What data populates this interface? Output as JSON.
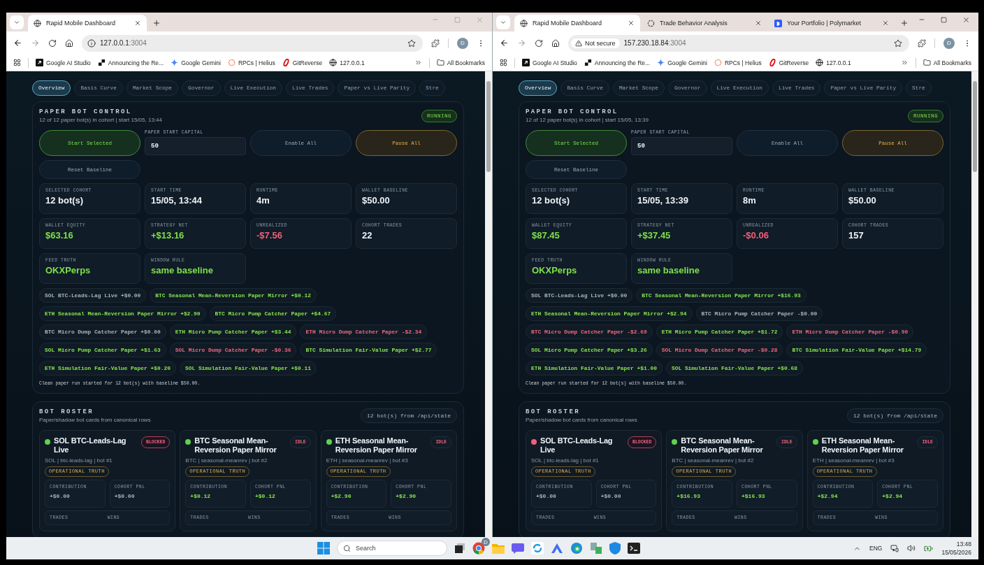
{
  "windows": [
    {
      "active": false,
      "tabs": [
        {
          "title": "Rapid Mobile Dashboard",
          "kind": "globe",
          "selected": true
        }
      ],
      "address": {
        "host": "127.0.0.1",
        "port": ":3004"
      },
      "profile_initial": "D",
      "bookmarks": [
        {
          "label": "Google AI Studio",
          "kind": "square"
        },
        {
          "label": "Announcing the Re...",
          "kind": "shape"
        },
        {
          "label": "Google Gemini",
          "kind": "sparkle"
        },
        {
          "label": "RPCs | Helius",
          "kind": "ring"
        },
        {
          "label": "GitReverse",
          "kind": "oval"
        },
        {
          "label": "127.0.0.1",
          "kind": "globe"
        }
      ],
      "bookmarks_folder": "All Bookmarks",
      "nav": [
        {
          "label": "Overview",
          "selected": true
        },
        {
          "label": "Basis Curve",
          "selected": false
        },
        {
          "label": "Market Scope",
          "selected": false
        },
        {
          "label": "Governor",
          "selected": false
        },
        {
          "label": "Live Execution",
          "selected": false
        },
        {
          "label": "Live Trades",
          "selected": false
        },
        {
          "label": "Paper vs Live Parity",
          "selected": false
        },
        {
          "label": "Stre",
          "selected": false
        }
      ],
      "control": {
        "title": "PAPER BOT CONTROL",
        "subtitle": "12 of 12 paper bot(s) in cohort | start 15/05, 13:44",
        "status": "RUNNING",
        "capital": {
          "label": "PAPER START CAPITAL",
          "value": "50"
        },
        "buttons": [
          {
            "label": "Start Selected",
            "kind": "start"
          },
          {
            "label": "Enable All",
            "kind": "plain"
          },
          {
            "label": "Pause All",
            "kind": "pause"
          },
          {
            "label": "Reset Baseline",
            "kind": "plain"
          }
        ],
        "stats": [
          {
            "label": "SELECTED COHORT",
            "value": "12 bot(s)",
            "color": "#eef3f8"
          },
          {
            "label": "START TIME",
            "value": "15/05, 13:44",
            "color": "#eef3f8"
          },
          {
            "label": "RUNTIME",
            "value": "4m",
            "color": "#eef3f8"
          },
          {
            "label": "WALLET BASELINE",
            "value": "$50.00",
            "color": "#eef3f8"
          },
          {
            "label": "WALLET EQUITY",
            "value": "$63.16",
            "color": "#7ee04a"
          },
          {
            "label": "STRATEGY NET",
            "value": "+$13.16",
            "color": "#7ee04a"
          },
          {
            "label": "UNREALIZED",
            "value": "-$7.56",
            "color": "#f0607a"
          },
          {
            "label": "COHORT TRADES",
            "value": "22",
            "color": "#eef3f8"
          },
          {
            "label": "FEED TRUTH",
            "value": "OKXPerps",
            "color": "#7ee04a"
          },
          {
            "label": "WINDOW RULE",
            "value": "same baseline",
            "color": "#7ee04a"
          }
        ],
        "chips": [
          {
            "label": "SOL BTC-Leads-Lag Live +$0.00",
            "color": "#a8b4c0"
          },
          {
            "label": "BTC Seasonal Mean-Reversion Paper Mirror +$0.12",
            "color": "#86e64f"
          },
          {
            "label": "ETH Seasonal Mean-Reversion Paper Mirror +$2.90",
            "color": "#86e64f"
          },
          {
            "label": "BTC Micro Pump Catcher Paper +$4.67",
            "color": "#86e64f"
          },
          {
            "label": "BTC Micro Dump Catcher Paper +$0.00",
            "color": "#a8b4c0"
          },
          {
            "label": "ETH Micro Pump Catcher Paper +$3.44",
            "color": "#86e64f"
          },
          {
            "label": "ETH Micro Dump Catcher Paper -$2.34",
            "color": "#f0687f"
          },
          {
            "label": "SOL Micro Pump Catcher Paper +$1.63",
            "color": "#86e64f"
          },
          {
            "label": "SOL Micro Dump Catcher Paper -$0.36",
            "color": "#f0687f"
          },
          {
            "label": "BTC Simulation Fair-Value Paper +$2.77",
            "color": "#86e64f"
          },
          {
            "label": "ETH Simulation Fair-Value Paper +$0.20",
            "color": "#86e64f"
          },
          {
            "label": "SOL Simulation Fair-Value Paper +$0.11",
            "color": "#86e64f"
          }
        ],
        "note": "Clean paper run started for 12 bot(s) with baseline $50.00."
      },
      "roster": {
        "title": "BOT ROSTER",
        "subtitle": "Paper/shadow bot cards from canonical rows",
        "badge": "12 bot(s) from /api/state",
        "bots": [
          {
            "name": "SOL BTC-Leads-Lag Live",
            "color": "#5fd34a",
            "status": "BLOCKED",
            "blocked": true,
            "meta": "SOL | btc-leads-lag | bot #1",
            "tag": "OPERATIONAL TRUTH",
            "metrics": [
              {
                "label": "CONTRIBUTION",
                "value": "+$0.00",
                "color": "#a8b4c0"
              },
              {
                "label": "COHORT PNL",
                "value": "+$0.00",
                "color": "#a8b4c0"
              }
            ],
            "footer": [
              "TRADES",
              "WINS"
            ]
          },
          {
            "name": "BTC Seasonal Mean-Reversion Paper Mirror",
            "color": "#5fd34a",
            "status": "IDLE",
            "blocked": false,
            "meta": "BTC | seasonal-meanrev | bot #2",
            "tag": "OPERATIONAL TRUTH",
            "metrics": [
              {
                "label": "CONTRIBUTION",
                "value": "+$0.12",
                "color": "#86e64f"
              },
              {
                "label": "COHORT PNL",
                "value": "+$0.12",
                "color": "#86e64f"
              }
            ],
            "footer": [
              "TRADES",
              "WINS"
            ]
          },
          {
            "name": "ETH Seasonal Mean-Reversion Paper Mirror",
            "color": "#5fd34a",
            "status": "IDLE",
            "blocked": false,
            "meta": "ETH | seasonal-meanrev | bot #3",
            "tag": "OPERATIONAL TRUTH",
            "metrics": [
              {
                "label": "CONTRIBUTION",
                "value": "+$2.90",
                "color": "#86e64f"
              },
              {
                "label": "COHORT PNL",
                "value": "+$2.90",
                "color": "#86e64f"
              }
            ],
            "footer": [
              "TRADES",
              "WINS"
            ]
          }
        ]
      }
    },
    {
      "active": true,
      "tabs": [
        {
          "title": "Rapid Mobile Dashboard",
          "kind": "globe",
          "selected": true
        },
        {
          "title": "Trade Behavior Analysis",
          "kind": "knot",
          "selected": false
        },
        {
          "title": "Your Portfolio | Polymarket",
          "kind": "square",
          "selected": false
        }
      ],
      "address": {
        "warning": "Not secure",
        "host": "157.230.18.84",
        "port": ":3004"
      },
      "profile_initial": "D",
      "bookmarks": [
        {
          "label": "Google AI Studio",
          "kind": "square"
        },
        {
          "label": "Announcing the Re...",
          "kind": "shape"
        },
        {
          "label": "Google Gemini",
          "kind": "sparkle"
        },
        {
          "label": "RPCs | Helius",
          "kind": "ring"
        },
        {
          "label": "GitReverse",
          "kind": "oval"
        },
        {
          "label": "127.0.0.1",
          "kind": "globe"
        }
      ],
      "bookmarks_folder": "All Bookmarks",
      "nav": [
        {
          "label": "Overview",
          "selected": true
        },
        {
          "label": "Basis Curve",
          "selected": false
        },
        {
          "label": "Market Scope",
          "selected": false
        },
        {
          "label": "Governor",
          "selected": false
        },
        {
          "label": "Live Execution",
          "selected": false
        },
        {
          "label": "Live Trades",
          "selected": false
        },
        {
          "label": "Paper vs Live Parity",
          "selected": false
        },
        {
          "label": "Stre",
          "selected": false
        }
      ],
      "control": {
        "title": "PAPER BOT CONTROL",
        "subtitle": "12 of 12 paper bot(s) in cohort | start 15/05, 13:39",
        "status": "RUNNING",
        "capital": {
          "label": "PAPER START CAPITAL",
          "value": "50"
        },
        "buttons": [
          {
            "label": "Start Selected",
            "kind": "start"
          },
          {
            "label": "Enable All",
            "kind": "plain"
          },
          {
            "label": "Pause All",
            "kind": "pause"
          },
          {
            "label": "Reset Baseline",
            "kind": "plain"
          }
        ],
        "stats": [
          {
            "label": "SELECTED COHORT",
            "value": "12 bot(s)",
            "color": "#eef3f8"
          },
          {
            "label": "START TIME",
            "value": "15/05, 13:39",
            "color": "#eef3f8"
          },
          {
            "label": "RUNTIME",
            "value": "8m",
            "color": "#eef3f8"
          },
          {
            "label": "WALLET BASELINE",
            "value": "$50.00",
            "color": "#eef3f8"
          },
          {
            "label": "WALLET EQUITY",
            "value": "$87.45",
            "color": "#7ee04a"
          },
          {
            "label": "STRATEGY NET",
            "value": "+$37.45",
            "color": "#7ee04a"
          },
          {
            "label": "UNREALIZED",
            "value": "-$0.06",
            "color": "#f0607a"
          },
          {
            "label": "COHORT TRADES",
            "value": "157",
            "color": "#eef3f8"
          },
          {
            "label": "FEED TRUTH",
            "value": "OKXPerps",
            "color": "#7ee04a"
          },
          {
            "label": "WINDOW RULE",
            "value": "same baseline",
            "color": "#7ee04a"
          }
        ],
        "chips": [
          {
            "label": "SOL BTC-Leads-Lag Live +$0.00",
            "color": "#a8b4c0"
          },
          {
            "label": "BTC Seasonal Mean-Reversion Paper Mirror +$16.93",
            "color": "#86e64f"
          },
          {
            "label": "ETH Seasonal Mean-Reversion Paper Mirror +$2.94",
            "color": "#86e64f"
          },
          {
            "label": "BTC Micro Pump Catcher Paper -$0.00",
            "color": "#a8b4c0"
          },
          {
            "label": "BTC Micro Dump Catcher Paper -$2.69",
            "color": "#f0687f"
          },
          {
            "label": "ETH Micro Pump Catcher Paper +$1.72",
            "color": "#86e64f"
          },
          {
            "label": "ETH Micro Dump Catcher Paper -$0.90",
            "color": "#f0687f"
          },
          {
            "label": "SOL Micro Pump Catcher Paper +$3.26",
            "color": "#86e64f"
          },
          {
            "label": "SOL Micro Dump Catcher Paper -$0.28",
            "color": "#f0687f"
          },
          {
            "label": "BTC Simulation Fair-Value Paper +$14.79",
            "color": "#86e64f"
          },
          {
            "label": "ETH Simulation Fair-Value Paper +$1.00",
            "color": "#86e64f"
          },
          {
            "label": "SOL Simulation Fair-Value Paper +$0.68",
            "color": "#86e64f"
          }
        ],
        "note": "Clean paper run started for 12 bot(s) with baseline $50.00."
      },
      "roster": {
        "title": "BOT ROSTER",
        "subtitle": "Paper/shadow bot cards from canonical rows",
        "badge": "12 bot(s) from /api/state",
        "bots": [
          {
            "name": "SOL BTC-Leads-Lag Live",
            "color": "#f0607a",
            "status": "BLOCKED",
            "blocked": true,
            "meta": "SOL | btc-leads-lag | bot #1",
            "tag": "OPERATIONAL TRUTH",
            "metrics": [
              {
                "label": "CONTRIBUTION",
                "value": "+$0.00",
                "color": "#a8b4c0"
              },
              {
                "label": "COHORT PNL",
                "value": "+$0.00",
                "color": "#a8b4c0"
              }
            ],
            "footer": [
              "TRADES",
              "WINS"
            ]
          },
          {
            "name": "BTC Seasonal Mean-Reversion Paper Mirror",
            "color": "#5fd34a",
            "status": "IDLE",
            "blocked": false,
            "meta": "BTC | seasonal-meanrev | bot #2",
            "tag": "OPERATIONAL TRUTH",
            "metrics": [
              {
                "label": "CONTRIBUTION",
                "value": "+$16.93",
                "color": "#86e64f"
              },
              {
                "label": "COHORT PNL",
                "value": "+$16.93",
                "color": "#86e64f"
              }
            ],
            "footer": [
              "TRADES",
              "WINS"
            ]
          },
          {
            "name": "ETH Seasonal Mean-Reversion Paper Mirror",
            "color": "#5fd34a",
            "status": "IDLE",
            "blocked": false,
            "meta": "ETH | seasonal-meanrev | bot #3",
            "tag": "OPERATIONAL TRUTH",
            "metrics": [
              {
                "label": "CONTRIBUTION",
                "value": "+$2.94",
                "color": "#86e64f"
              },
              {
                "label": "COHORT PNL",
                "value": "+$2.94",
                "color": "#86e64f"
              }
            ],
            "footer": [
              "TRADES",
              "WINS"
            ]
          }
        ]
      }
    }
  ],
  "taskbar": {
    "search": "Search",
    "apps": [
      {
        "kind": "task-view"
      },
      {
        "kind": "browser",
        "badge": "D"
      },
      {
        "kind": "folder"
      },
      {
        "kind": "chat"
      },
      {
        "kind": "sync"
      },
      {
        "kind": "arch"
      },
      {
        "kind": "edge"
      },
      {
        "kind": "transfer"
      },
      {
        "kind": "shield"
      },
      {
        "kind": "terminal"
      }
    ],
    "language": "ENG",
    "time": "13:48",
    "date": "15/05/2026"
  }
}
